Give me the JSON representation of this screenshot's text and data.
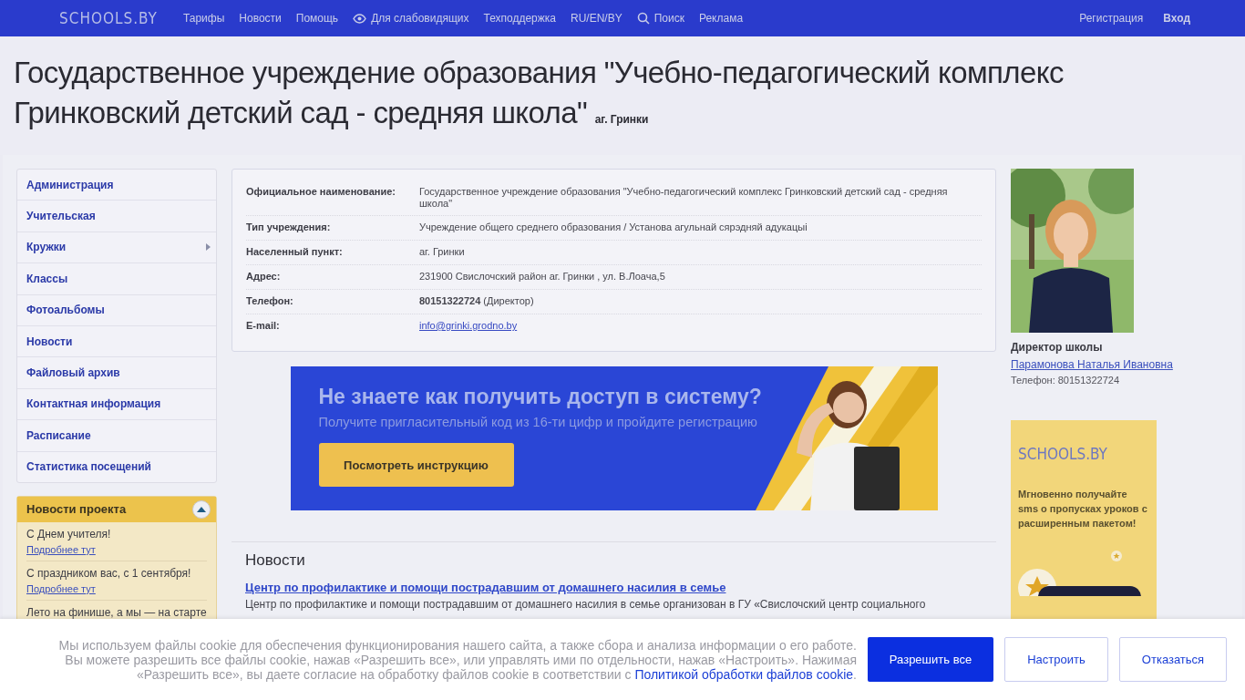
{
  "topnav": {
    "logo": "SCHOOLS.BY",
    "items": [
      {
        "label": "Тарифы"
      },
      {
        "label": "Новости"
      },
      {
        "label": "Помощь"
      },
      {
        "label": "Для слабовидящих",
        "kind": "eye"
      },
      {
        "label": "Техподдержка"
      },
      {
        "label": "RU/EN/BY"
      },
      {
        "label": "Поиск",
        "kind": "search"
      },
      {
        "label": "Реклама"
      }
    ],
    "register": "Регистрация",
    "login": "Вход"
  },
  "hero": {
    "title": "Государственное учреждение образования \"Учебно-педагогический комплекс Гринковский детский сад - средняя школа\"",
    "locality": "аг. Гринки"
  },
  "sidebar": {
    "menu": [
      {
        "label": "Администрация",
        "has_submenu": false
      },
      {
        "label": "Учительская",
        "has_submenu": false
      },
      {
        "label": "Кружки",
        "has_submenu": true
      },
      {
        "label": "Классы",
        "has_submenu": false
      },
      {
        "label": "Фотоальбомы",
        "has_submenu": false
      },
      {
        "label": "Новости",
        "has_submenu": false
      },
      {
        "label": "Файловый архив",
        "has_submenu": false
      },
      {
        "label": "Контактная информация",
        "has_submenu": false
      },
      {
        "label": "Расписание",
        "has_submenu": false
      },
      {
        "label": "Статистика посещений",
        "has_submenu": false
      }
    ],
    "project_news": {
      "title": "Новости проекта",
      "expanded": true,
      "items": [
        {
          "text": "С Днем учителя!",
          "link": "Подробнее тут"
        },
        {
          "text": "С праздником вас, с 1 сентября!",
          "link": "Подробнее тут"
        },
        {
          "text": "Лето на финише, а мы — на старте"
        }
      ]
    }
  },
  "info": {
    "rows": [
      {
        "label": "Официальное наименование:",
        "value": "Государственное учреждение образования \"Учебно-педагогический комплекс Гринковский детский сад - средняя школа\"",
        "kind": "text"
      },
      {
        "label": "Тип учреждения:",
        "value": "Учреждение общего среднего образования / Установа агульнай сярэдняй адукацыі",
        "kind": "text"
      },
      {
        "label": "Населенный пункт:",
        "value": "аг. Гринки",
        "kind": "text"
      },
      {
        "label": "Адрес:",
        "value": "231900 Свислочский район аг. Гринки , ул. В.Лоача,5",
        "kind": "text"
      },
      {
        "label": "Телефон:",
        "value": "**80151322724** (Директор)",
        "kind": "text"
      },
      {
        "label": "E-mail:",
        "value": "info@grinki.grodno.by",
        "kind": "email"
      }
    ]
  },
  "promo": {
    "title": "Не знаете как получить доступ в систему?",
    "subtitle": "Получите пригласительный код из 16-ти цифр и пройдите регистрацию",
    "button": "Посмотреть инструкцию"
  },
  "news": {
    "heading": "Новости",
    "items": [
      {
        "title": "Центр по профилактике и помощи пострадавшим от домашнего насилия в семье",
        "excerpt": "Центр по профилактике и помощи пострадавшим от домашнего насилия в семье организован в ГУ «Свислочский центр социального"
      }
    ]
  },
  "director": {
    "role": "Директор школы",
    "name": "Парамонова Наталья Ивановна",
    "phone": "Телефон: 80151322724"
  },
  "ad": {
    "logo": "SCHOOLS.BY",
    "text": "Мгновенно получайте sms о пропусках уроков с расширенным пакетом!"
  },
  "cookie": {
    "text": "Мы используем файлы cookie для обеспечения функционирования нашего сайта, а также сбора и анализа информации о его работе. Вы можете разрешить все файлы cookie, нажав «Разрешить все», или управлять ими по отдельности, нажав «Настроить». Нажимая «Разрешить все», вы даете согласие на обработку файлов cookie в соответствии с",
    "link": "Политикой обработки файлов cookie",
    "end": ".",
    "buttons": [
      {
        "label": "Разрешить все",
        "kind": "primary"
      },
      {
        "label": "Настроить",
        "kind": "outline"
      },
      {
        "label": "Отказаться",
        "kind": "outline"
      }
    ]
  }
}
